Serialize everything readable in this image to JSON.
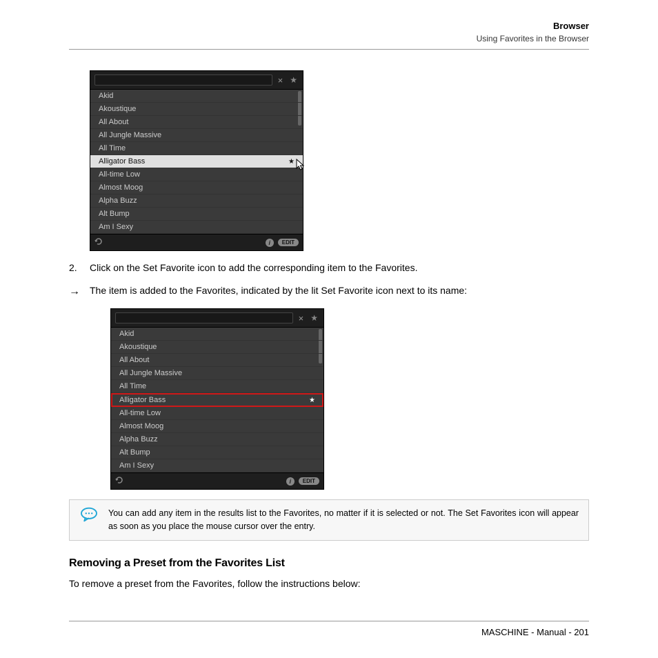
{
  "header": {
    "title": "Browser",
    "subtitle": "Using Favorites in the Browser"
  },
  "step2": {
    "num": "2.",
    "text": "Click on the Set Favorite icon to add the corresponding item to the Favorites."
  },
  "result": {
    "arrow": "→",
    "text": "The item is added to the Favorites, indicated by the lit Set Favorite icon next to its name:"
  },
  "panel": {
    "items": [
      "Akid",
      "Akoustique",
      "All About",
      "All Jungle Massive",
      "All Time",
      "Alligator Bass",
      "All-time Low",
      "Almost Moog",
      "Alpha Buzz",
      "Alt Bump",
      "Am I Sexy"
    ],
    "selected_index": 5,
    "edit_label": "EDIT",
    "close": "×",
    "star": "★"
  },
  "note": "You can add any item in the results list to the Favorites, no matter if it is selected or not. The Set Favorites icon will appear as soon as you place the mouse cursor over the entry.",
  "heading": "Removing a Preset from the Favorites List",
  "body": "To remove a preset from the Favorites, follow the instructions below:",
  "footer": "MASCHINE - Manual - 201"
}
